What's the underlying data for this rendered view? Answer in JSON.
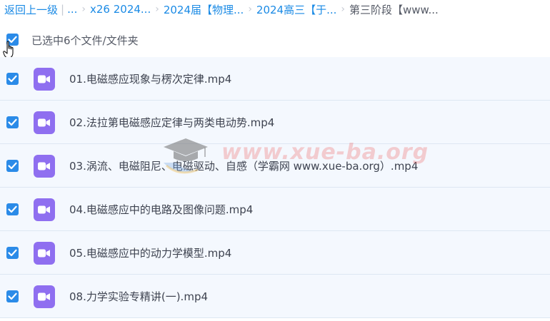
{
  "breadcrumb": {
    "back_label": "返回上一级",
    "separator": "|",
    "ellipsis": "...",
    "crumb_1": "x26 2024...",
    "crumb_2": "2024届【物理...",
    "crumb_3": "2024高三【于...",
    "current": "第三阶段【www..."
  },
  "selection": {
    "checked": true,
    "label": "已选中6个文件/文件夹"
  },
  "files": [
    {
      "name": "01.电磁感应现象与楞次定律.mp4",
      "checked": true,
      "icon": "video-file-icon"
    },
    {
      "name": "02.法拉第电磁感应定律与两类电动势.mp4",
      "checked": true,
      "icon": "video-file-icon"
    },
    {
      "name": "03.涡流、电磁阻尼、电磁驱动、自感（学霸网 www.xue-ba.org）.mp4",
      "checked": true,
      "icon": "video-file-icon"
    },
    {
      "name": "04.电磁感应中的电路及图像问题.mp4",
      "checked": true,
      "icon": "video-file-icon"
    },
    {
      "name": "05.电磁感应中的动力学模型.mp4",
      "checked": true,
      "icon": "video-file-icon"
    },
    {
      "name": "08.力学实验专精讲(一).mp4",
      "checked": true,
      "icon": "video-file-icon"
    }
  ],
  "watermark": {
    "text": "www.xue-ba.org",
    "icon": "graduation-cap-icon"
  },
  "colors": {
    "link": "#1a8ae5",
    "checkbox": "#2b8be8",
    "row_bg": "#f4f8fe",
    "row_border": "#dde7f3",
    "video_icon": "#8f6ff0"
  }
}
